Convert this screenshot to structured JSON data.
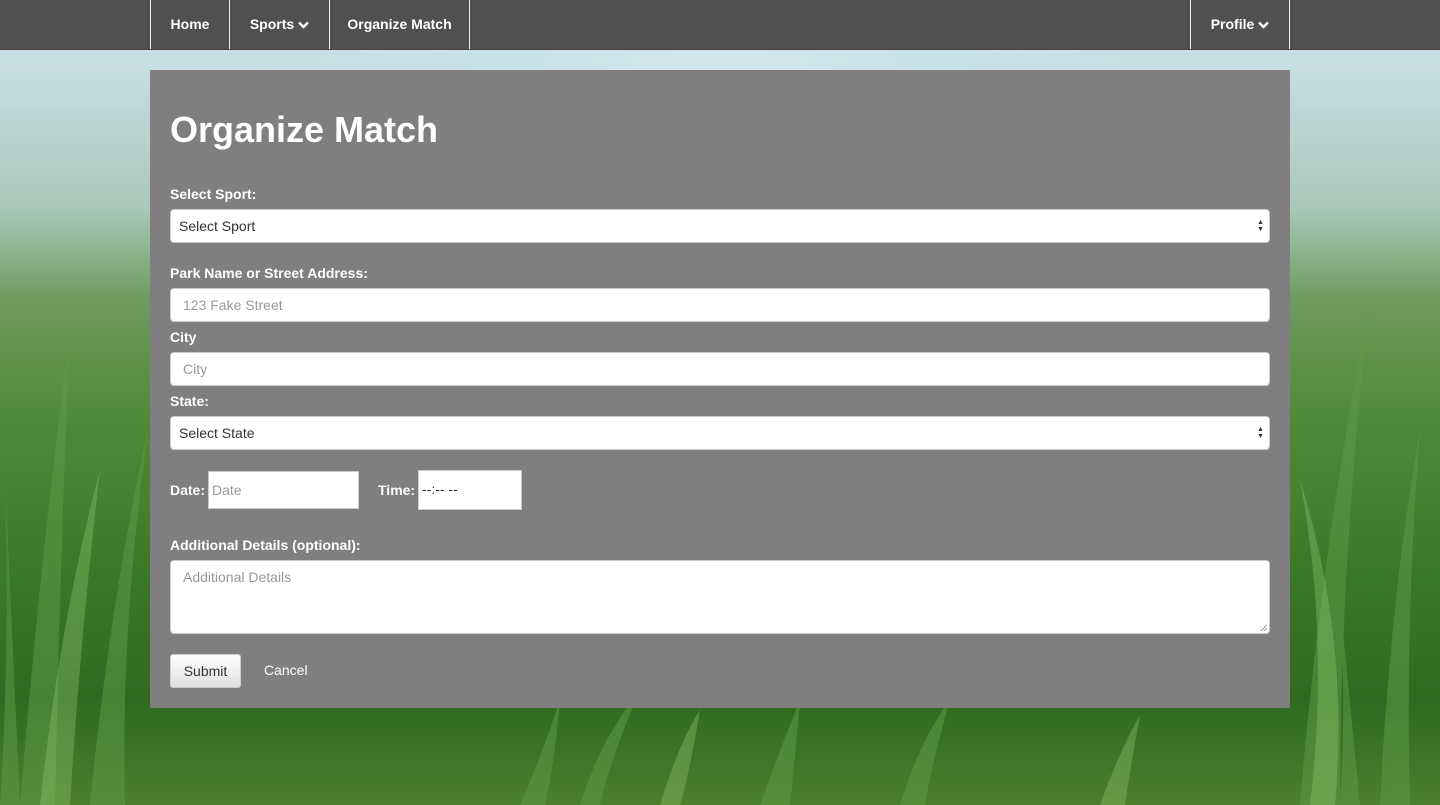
{
  "nav": {
    "home": "Home",
    "sports": "Sports",
    "organize": "Organize Match",
    "profile": "Profile"
  },
  "form": {
    "title": "Organize Match",
    "sport_label": "Select Sport:",
    "sport_value": "Select Sport",
    "address_label": "Park Name or Street Address:",
    "address_placeholder": "123 Fake Street",
    "city_label": "City",
    "city_placeholder": "City",
    "state_label": "State:",
    "state_value": "Select State",
    "date_label": "Date:",
    "date_placeholder": "Date",
    "time_label": "Time:",
    "time_value": "--:-- --",
    "details_label": "Additional Details (optional):",
    "details_placeholder": "Additional Details",
    "submit": "Submit",
    "cancel": "Cancel"
  },
  "colors": {
    "navbar": "#505050",
    "panel": "#7f7f7f"
  }
}
